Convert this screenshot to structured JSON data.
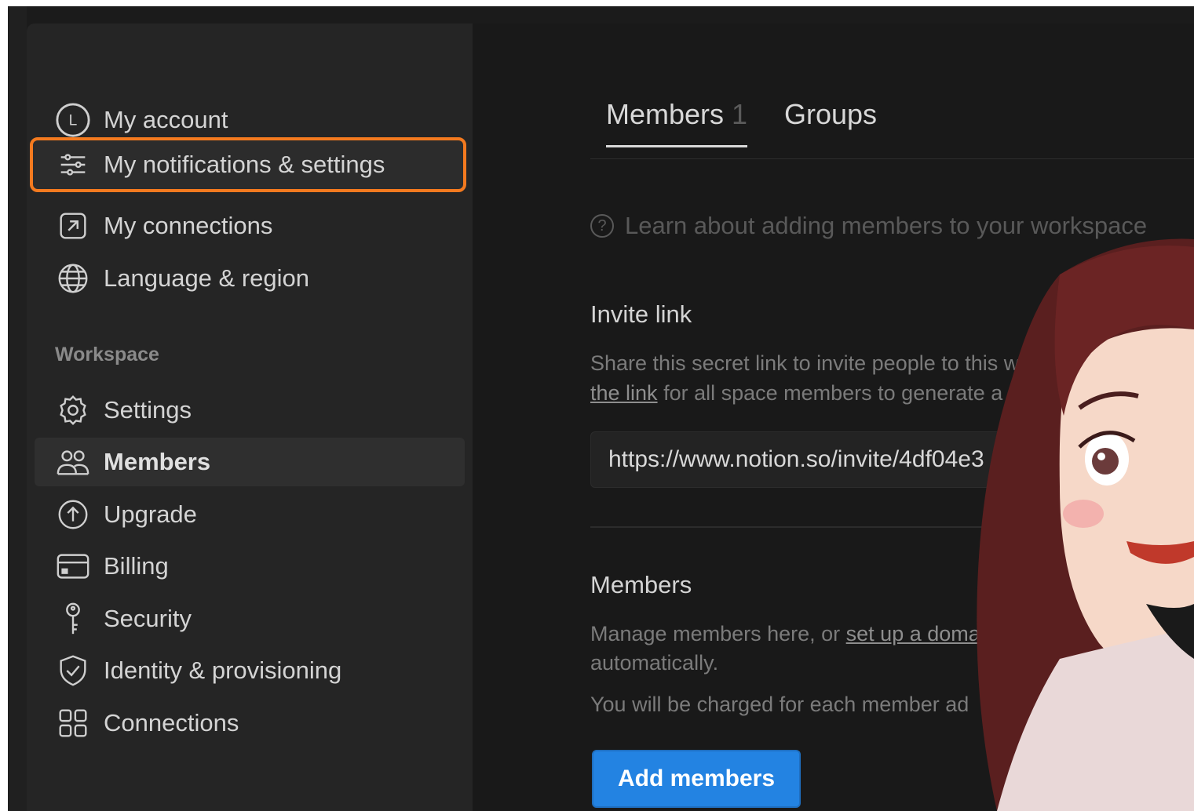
{
  "sidebar": {
    "account_items": [
      {
        "label": "My account",
        "icon": "user-circle-icon"
      },
      {
        "label": "My notifications & settings",
        "icon": "sliders-icon"
      },
      {
        "label": "My connections",
        "icon": "arrow-up-right-box-icon"
      },
      {
        "label": "Language & region",
        "icon": "globe-icon"
      }
    ],
    "workspace_label": "Workspace",
    "workspace_items": [
      {
        "label": "Settings",
        "icon": "gear-icon"
      },
      {
        "label": "Members",
        "icon": "people-icon"
      },
      {
        "label": "Upgrade",
        "icon": "arrow-up-circle-icon"
      },
      {
        "label": "Billing",
        "icon": "credit-card-icon"
      },
      {
        "label": "Security",
        "icon": "key-icon"
      },
      {
        "label": "Identity & provisioning",
        "icon": "shield-check-icon"
      },
      {
        "label": "Connections",
        "icon": "grid-icon"
      }
    ]
  },
  "main": {
    "tabs": [
      {
        "label": "Members",
        "count": "1"
      },
      {
        "label": "Groups"
      }
    ],
    "learn_link": "Learn about adding members to your workspace",
    "invite": {
      "title": "Invite link",
      "desc_line1": "Share this secret link to invite people to this w",
      "desc_line2_link": "the link",
      "desc_line2_rest": " for all space members to generate a n",
      "url": "https://www.notion.so/invite/4df04e3"
    },
    "members": {
      "title": "Members",
      "desc_line1_pre": "Manage members here, or ",
      "desc_line1_link": "set up a doma",
      "desc_line2": "automatically.",
      "desc_line3": "You will be charged for each member ad",
      "add_button": "Add members"
    }
  },
  "colors": {
    "highlight": "#f47a1f",
    "primary_button": "#2383e2",
    "active_item_bg": "#2f2f2f"
  }
}
